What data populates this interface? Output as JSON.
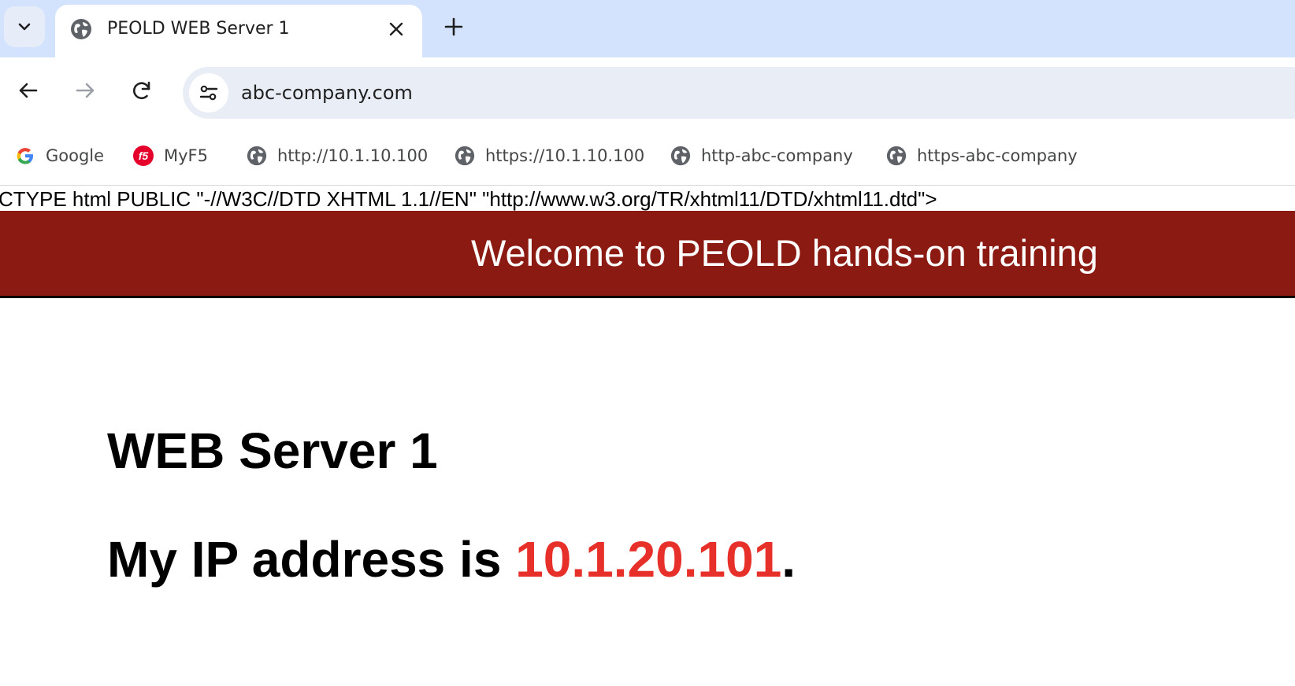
{
  "browser": {
    "tab": {
      "title": "PEOLD WEB Server 1",
      "favicon": "globe-icon"
    },
    "address_bar": {
      "url": "abc-company.com"
    },
    "bookmarks": [
      {
        "label": "Google",
        "icon": "google-icon"
      },
      {
        "label": "MyF5",
        "icon": "f5-icon"
      },
      {
        "label": "http://10.1.10.100",
        "icon": "globe-icon"
      },
      {
        "label": "https://10.1.10.100",
        "icon": "globe-icon"
      },
      {
        "label": "http-abc-company",
        "icon": "globe-icon"
      },
      {
        "label": "https-abc-company",
        "icon": "globe-icon"
      }
    ]
  },
  "page": {
    "doctype_text": "CTYPE html PUBLIC \"-//W3C//DTD XHTML 1.1//EN\" \"http://www.w3.org/TR/xhtml11/DTD/xhtml11.dtd\">",
    "banner_text": "Welcome to PEOLD hands-on training",
    "server_heading": "WEB Server 1",
    "ip_prefix": "My IP address is ",
    "ip_address": "10.1.20.101",
    "ip_suffix": "."
  },
  "colors": {
    "tabstrip_bg": "#d3e3fd",
    "banner_bg": "#8b1a12",
    "ip_highlight": "#e8302a"
  }
}
